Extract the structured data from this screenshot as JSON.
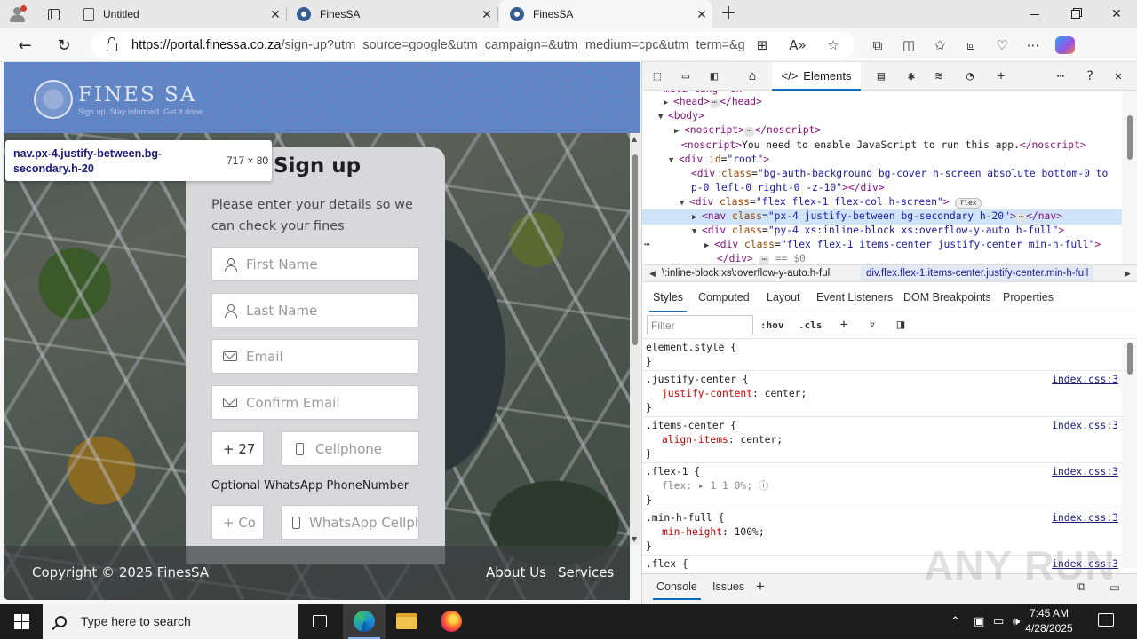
{
  "browser": {
    "tabs": [
      {
        "title": "Untitled",
        "icon": "document-icon"
      },
      {
        "title": "FinesSA",
        "icon": "finessa-favicon"
      },
      {
        "title": "FinesSA",
        "icon": "finessa-favicon",
        "active": true
      }
    ],
    "url_host": "https://portal.finessa.co.za",
    "url_path": "/sign-up?utm_source=google&utm_campaign=&utm_medium=cpc&utm_term=&gc..."
  },
  "page": {
    "logo_name": "FINES SA",
    "logo_tagline": "Sign up. Stay informed. Get it done.",
    "inspect_tooltip": {
      "selector": "nav.px-4.justify-between.bg-secondary.h-20",
      "dimensions": "717 × 80"
    },
    "signup": {
      "title": "Sign up",
      "lead": "Please enter your details so we can check your fines",
      "first_name_placeholder": "First Name",
      "last_name_placeholder": "Last Name",
      "email_placeholder": "Email",
      "confirm_email_placeholder": "Confirm Email",
      "country_code_value": "+ 27",
      "cellphone_placeholder": "Cellphone",
      "whatsapp_label": "Optional WhatsApp PhoneNumber",
      "wa_code_placeholder": "+ Co",
      "whatsapp_placeholder": "WhatsApp Cellphone"
    },
    "footer": {
      "copyright": "Copyright © 2025 FinesSA",
      "links": [
        "About Us",
        "Services"
      ]
    }
  },
  "devtools": {
    "panel_tab": "Elements",
    "dom": {
      "l0": "meta-tag-cut",
      "head_open": "<head>",
      "head_close": "</head>",
      "body_open": "<body>",
      "noscript1_open": "<noscript>",
      "noscript1_close": "</noscript>",
      "noscript2_text": "You need to enable JavaScript to run this app.",
      "root_id": "root",
      "bg_class_a": "bg-auth-background bg-cover h-screen absolute bottom-0 to",
      "bg_class_b": "p-0 left-0 right-0 -z-10",
      "flex_class": "flex flex-1 flex-col h-screen",
      "flex_badge": "flex",
      "nav_class": "px-4 justify-between bg-secondary h-20",
      "py_class": "py-4 xs:inline-block xs:overflow-y-auto h-full",
      "inner_class": "flex flex-1 items-center justify-center min-h-full"
    },
    "breadcrumbs": [
      "\\:inline-block.xs\\:overflow-y-auto.h-full",
      "div.flex.flex-1.items-center.justify-center.min-h-full"
    ],
    "subtabs": [
      "Styles",
      "Computed",
      "Layout",
      "Event Listeners",
      "DOM Breakpoints",
      "Properties"
    ],
    "filter_placeholder": "Filter",
    "hov": ":hov",
    "cls": ".cls",
    "styles": {
      "element_style": "element.style {",
      "close": "}",
      "source": "index.css:3",
      "rules": [
        {
          "selector": ".justify-center {",
          "prop": "justify-content",
          "value": "center;"
        },
        {
          "selector": ".items-center {",
          "prop": "align-items",
          "value": "center;"
        },
        {
          "selector": ".flex-1 {",
          "prop": "flex",
          "value": "▸ 1 1 0%;"
        },
        {
          "selector": ".min-h-full {",
          "prop": "min-height",
          "value": "100%;"
        },
        {
          "selector": ".flex {"
        }
      ]
    },
    "drawer_tabs": [
      "Console",
      "Issues"
    ]
  },
  "watermark": "ANY RUN",
  "taskbar": {
    "search_placeholder": "Type here to search",
    "time": "7:45 AM",
    "date": "4/28/2025"
  }
}
